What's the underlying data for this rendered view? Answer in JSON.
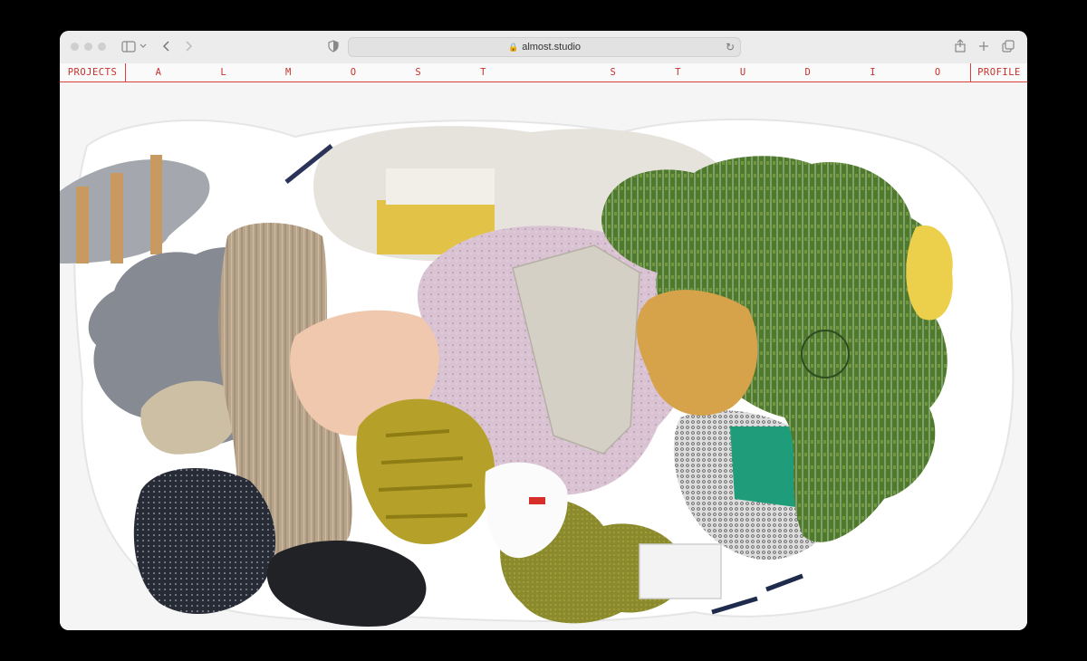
{
  "browser": {
    "url": "almost.studio",
    "icons": [
      "sidebar-icon",
      "chevron-down-icon",
      "back-icon",
      "forward-icon",
      "shield-icon",
      "lock-icon",
      "reload-icon",
      "share-icon",
      "new-tab-icon",
      "tabs-overview-icon"
    ]
  },
  "site": {
    "nav_left": "PROJECTS",
    "nav_right": "PROFILE",
    "title_letters": [
      "A",
      "L",
      "M",
      "O",
      "S",
      "T",
      "",
      "S",
      "T",
      "U",
      "D",
      "I",
      "O"
    ],
    "accent_color": "#c9302c"
  }
}
